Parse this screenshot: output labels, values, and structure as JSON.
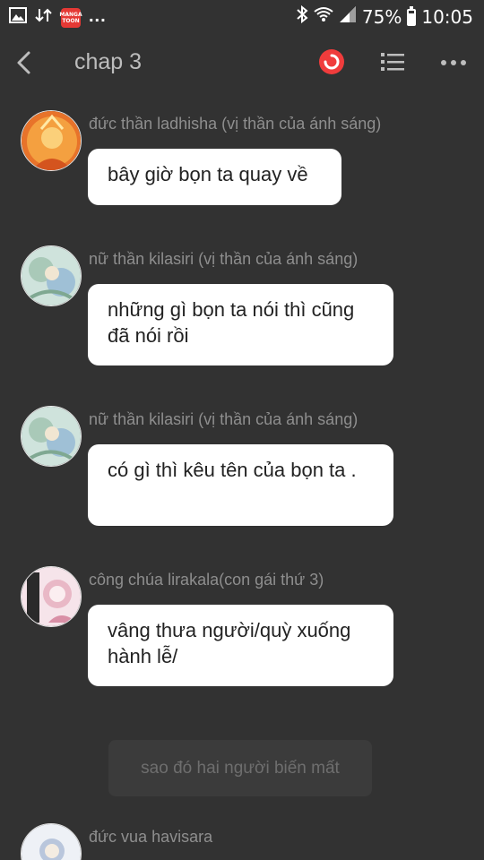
{
  "status_bar": {
    "app_badge_text": "MANGA TOON",
    "more_dots": "...",
    "battery_percent": "75%",
    "battery_level": 0.75,
    "time": "10:05"
  },
  "header": {
    "title": "chap 3"
  },
  "messages": [
    {
      "sender": "đức thần ladhisha (vị thần của ánh sáng)",
      "text": "bây giờ bọn ta quay về",
      "avatar_color": "#e8732a"
    },
    {
      "sender": "nữ thần kilasiri  (vị thần của ánh sáng)",
      "text": "những gì bọn ta nói thì cũng đã nói rồi",
      "avatar_color": "#a9c9b8"
    },
    {
      "sender": "nữ thần kilasiri  (vị thần của ánh sáng)",
      "text": "có gì thì kêu tên của bọn ta .",
      "avatar_color": "#a9c9b8"
    },
    {
      "sender": "công chúa lirakala(con gái thứ 3)",
      "text": "vâng thưa người/quỳ xuống hành lễ/",
      "avatar_color": "#e9b8c6"
    }
  ],
  "system_message": "sao đó hai người biến mất",
  "last_message": {
    "sender": "đức vua havisara",
    "avatar_color": "#b9c6dc"
  },
  "colors": {
    "background": "#323232",
    "record_red": "#f03c3c",
    "icon_gray": "#bdbdbd",
    "sender_gray": "#8e8e8e"
  }
}
